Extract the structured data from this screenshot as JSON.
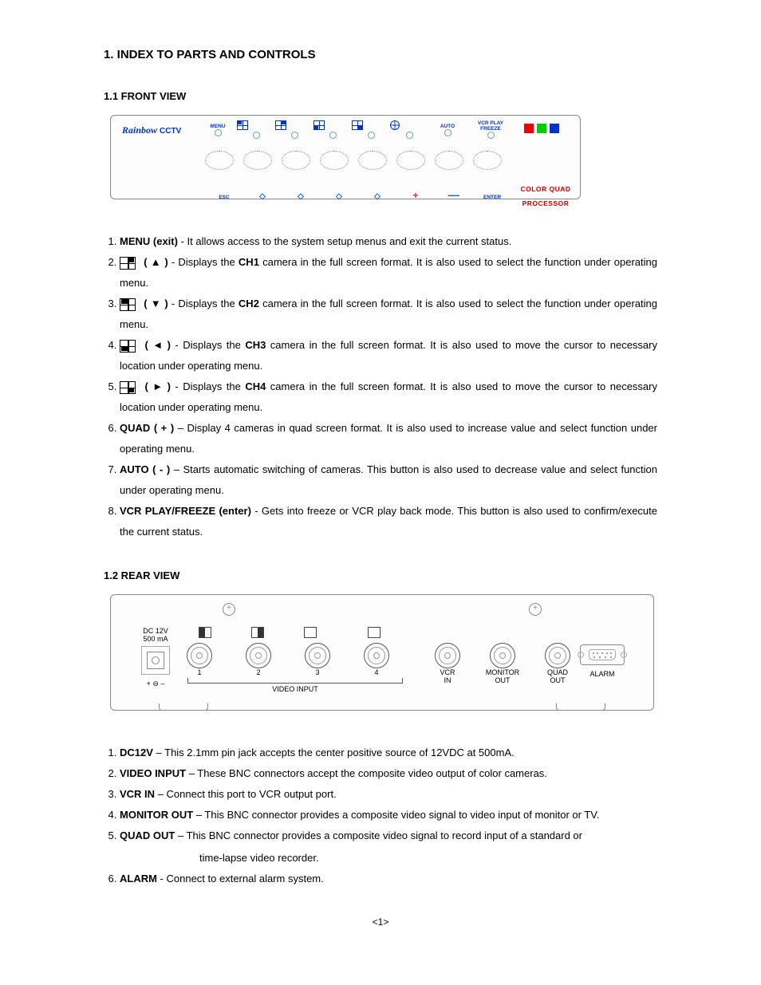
{
  "title": "1. INDEX TO PARTS AND CONTROLS",
  "front": {
    "heading": "1.1 FRONT VIEW",
    "logo_cursive": "Rainbow",
    "logo_suffix": "CCTV",
    "labels": {
      "menu": "MENU",
      "auto": "AUTO",
      "vcr": "VCR PLAY\nFREEZE",
      "esc": "ESC",
      "enter": "ENTER",
      "cqp": "COLOR QUAD PROCESSOR"
    }
  },
  "front_items": [
    {
      "lead": "MENU (exit)",
      "sep": " - ",
      "text": "It allows access to the system setup menus and exit the current status."
    },
    {
      "icon": "q2",
      "arrow": "( ▲ )",
      "sep": " - ",
      "text": "Displays the ",
      "bold": "CH1",
      "text2": " camera in the full screen format.   It is also used to select the function under operating menu."
    },
    {
      "icon": "q1",
      "arrow": "( ▼ )",
      "sep": " - ",
      "text": "Displays the ",
      "bold": "CH2",
      "text2": " camera in the full screen format.   It is also used to select the function under operating menu."
    },
    {
      "icon": "q3",
      "arrow": "( ◄ )",
      "sep": " - ",
      "text": "Displays the ",
      "bold": "CH3",
      "text2": " camera in the full screen format.   It is also used to move the cursor to necessary location under operating menu."
    },
    {
      "icon": "q4",
      "arrow": "( ► )",
      "sep": " - ",
      "text": "Displays the ",
      "bold": "CH4",
      "text2": " camera in the full screen format.   It is also used to move the cursor to necessary location under operating menu."
    },
    {
      "lead": "QUAD  ( + )",
      "sep": " – ",
      "text": "Display 4 cameras in quad screen format.   It is also used to increase value and select function under operating menu."
    },
    {
      "lead": "AUTO ( - )",
      "sep": " – ",
      "text": "Starts automatic switching of cameras.   This button is also used to decrease value and select function under operating menu."
    },
    {
      "lead": "VCR PLAY/FREEZE (enter)",
      "sep": " - ",
      "text": "Gets into freeze or VCR play back mode.   This button is also used to confirm/execute the current status."
    }
  ],
  "rear": {
    "heading": "1.2 REAR VIEW",
    "labels": {
      "dc": "DC 12V",
      "ma": "500 mA",
      "polarity": "+ ⊖ –",
      "video_input": "VIDEO  INPUT",
      "n1": "1",
      "n2": "2",
      "n3": "3",
      "n4": "4",
      "vcr_in": "VCR\nIN",
      "mon_out": "MONITOR\nOUT",
      "quad_out": "QUAD\nOUT",
      "alarm": "ALARM"
    }
  },
  "rear_items": [
    {
      "lead": "DC12V",
      "sep": " – ",
      "text": "This 2.1mm pin jack accepts the center positive source of 12VDC at 500mA."
    },
    {
      "lead": "VIDEO INPUT",
      "sep": " – ",
      "text": "These BNC connectors accept the composite video output of color cameras."
    },
    {
      "lead": "VCR IN",
      "sep": " – ",
      "text": "Connect this port to VCR output port."
    },
    {
      "lead": "MONITOR OUT",
      "sep": " – ",
      "text": "This BNC connector provides a composite video signal to video input of monitor or TV."
    },
    {
      "lead": "QUAD OUT",
      "sep": " – ",
      "text": "This BNC connector provides a composite video signal to record input of a standard or",
      "cont": "time-lapse video recorder."
    },
    {
      "lead": "ALARM",
      "sep": " - ",
      "text": "Connect to external alarm system."
    }
  ],
  "page_number": "<1>"
}
